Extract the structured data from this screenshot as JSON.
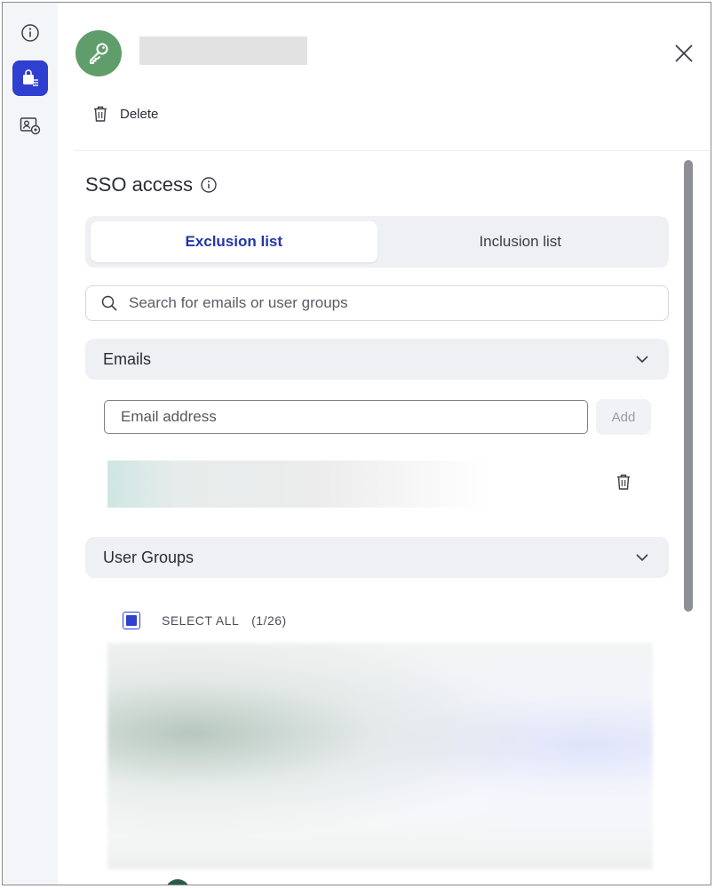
{
  "rail": {
    "items": [
      {
        "icon": "info-icon",
        "active": false
      },
      {
        "icon": "access-bag-icon",
        "active": true
      },
      {
        "icon": "user-card-settings-icon",
        "active": false
      }
    ]
  },
  "header": {
    "avatar_icon": "key-icon",
    "avatar_color": "#5f9e6a",
    "close_icon": "close-icon"
  },
  "actions": {
    "delete_label": "Delete"
  },
  "sso": {
    "title": "SSO access",
    "tabs": [
      {
        "label": "Exclusion list",
        "active": true
      },
      {
        "label": "Inclusion list",
        "active": false
      }
    ],
    "search_placeholder": "Search for emails or user groups",
    "emails": {
      "header": "Emails",
      "input_placeholder": "Email address",
      "add_label": "Add"
    },
    "user_groups": {
      "header": "User Groups",
      "select_all_label": "SELECT ALL",
      "select_all_count": "(1/26)"
    }
  },
  "colors": {
    "accent": "#2f3fd0",
    "active_tab_text": "#2336a8"
  }
}
